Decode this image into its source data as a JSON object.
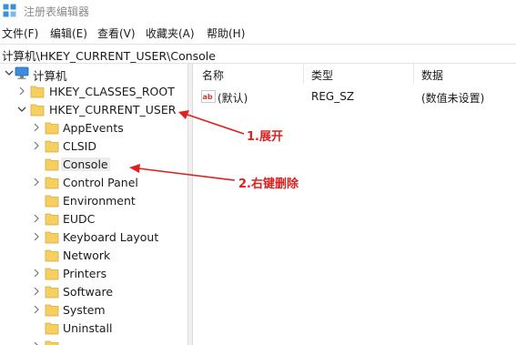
{
  "window": {
    "title": "注册表编辑器"
  },
  "menu": [
    {
      "label": "文件(F)"
    },
    {
      "label": "编辑(E)"
    },
    {
      "label": "查看(V)"
    },
    {
      "label": "收藏夹(A)"
    },
    {
      "label": "帮助(H)"
    }
  ],
  "address": {
    "path": "计算机\\HKEY_CURRENT_USER\\Console"
  },
  "tree": {
    "root": "计算机",
    "hives": [
      {
        "label": "HKEY_CLASSES_ROOT",
        "expanded": false
      },
      {
        "label": "HKEY_CURRENT_USER",
        "expanded": true
      }
    ],
    "children": [
      {
        "label": "AppEvents",
        "expandable": true,
        "selected": false
      },
      {
        "label": "CLSID",
        "expandable": true,
        "selected": false
      },
      {
        "label": "Console",
        "expandable": false,
        "selected": true
      },
      {
        "label": "Control Panel",
        "expandable": true,
        "selected": false
      },
      {
        "label": "Environment",
        "expandable": false,
        "selected": false
      },
      {
        "label": "EUDC",
        "expandable": true,
        "selected": false
      },
      {
        "label": "Keyboard Layout",
        "expandable": true,
        "selected": false
      },
      {
        "label": "Network",
        "expandable": false,
        "selected": false
      },
      {
        "label": "Printers",
        "expandable": true,
        "selected": false
      },
      {
        "label": "Software",
        "expandable": true,
        "selected": false
      },
      {
        "label": "System",
        "expandable": true,
        "selected": false
      },
      {
        "label": "Uninstall",
        "expandable": false,
        "selected": false
      }
    ]
  },
  "list": {
    "headers": [
      "名称",
      "类型",
      "数据"
    ],
    "rows": [
      {
        "name": "(默认)",
        "type": "REG_SZ",
        "data": "(数值未设置)"
      }
    ]
  },
  "annotations": [
    {
      "text": "1.展开"
    },
    {
      "text": "2.右键删除"
    }
  ],
  "colors": {
    "annotation": "#e02020",
    "folder": "#f5cf60",
    "accent": "#2e7cd6"
  }
}
